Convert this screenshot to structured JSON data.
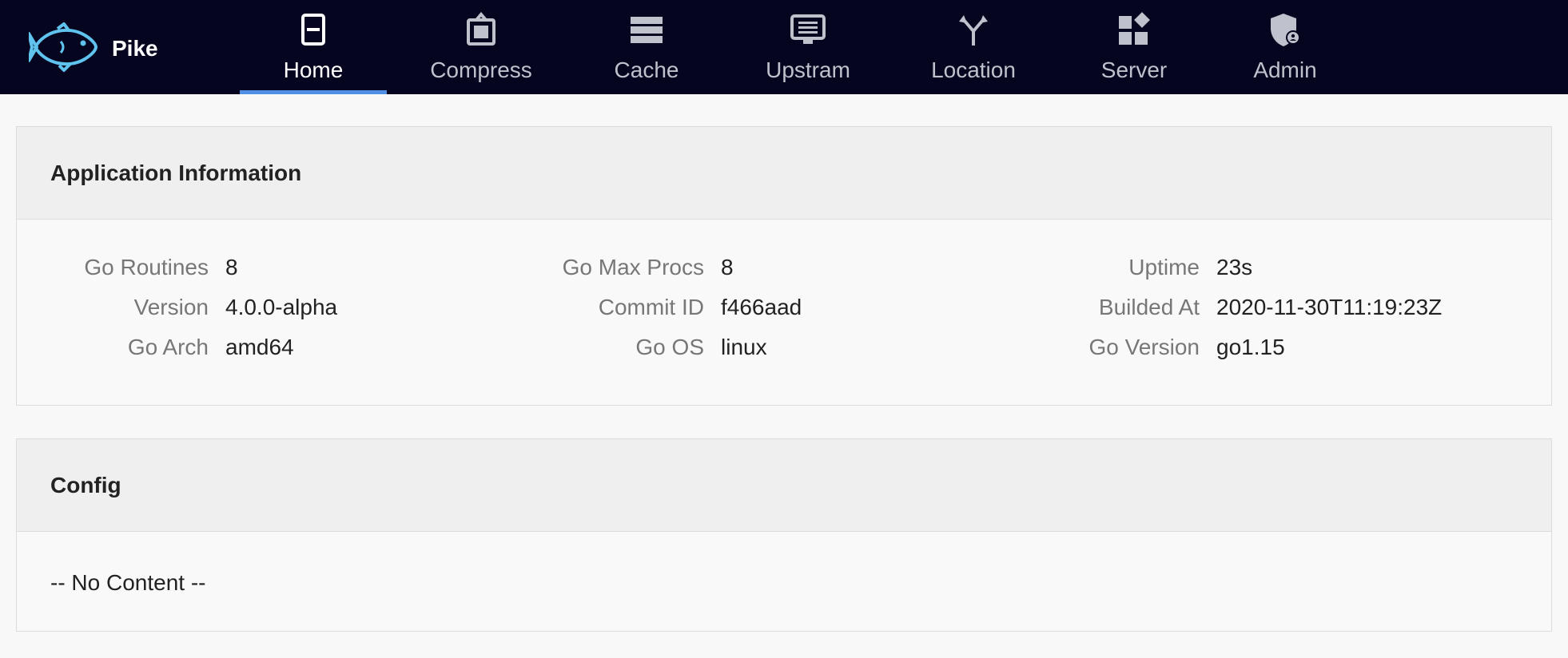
{
  "app": {
    "name": "Pike",
    "logo_icon": "fish-icon"
  },
  "nav": {
    "items": [
      {
        "label": "Home",
        "icon": "home-icon",
        "active": true
      },
      {
        "label": "Compress",
        "icon": "compress-icon",
        "active": false
      },
      {
        "label": "Cache",
        "icon": "cache-icon",
        "active": false
      },
      {
        "label": "Upstram",
        "icon": "upstream-icon",
        "active": false
      },
      {
        "label": "Location",
        "icon": "location-icon",
        "active": false
      },
      {
        "label": "Server",
        "icon": "server-icon",
        "active": false
      },
      {
        "label": "Admin",
        "icon": "admin-icon",
        "active": false
      }
    ],
    "active_color": "#4f8fe6"
  },
  "app_info": {
    "title": "Application Information",
    "fields": [
      {
        "label": "Go Routines",
        "value": "8"
      },
      {
        "label": "Go Max Procs",
        "value": "8"
      },
      {
        "label": "Uptime",
        "value": "23s"
      },
      {
        "label": "Version",
        "value": "4.0.0-alpha"
      },
      {
        "label": "Commit ID",
        "value": "f466aad"
      },
      {
        "label": "Builded At",
        "value": "2020-11-30T11:19:23Z"
      },
      {
        "label": "Go Arch",
        "value": "amd64"
      },
      {
        "label": "Go OS",
        "value": "linux"
      },
      {
        "label": "Go Version",
        "value": "go1.15"
      }
    ]
  },
  "config": {
    "title": "Config",
    "empty_text": "-- No Content --"
  }
}
